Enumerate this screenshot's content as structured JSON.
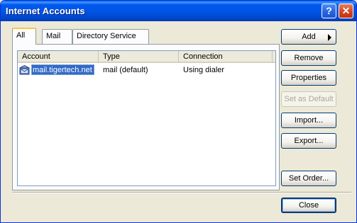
{
  "window": {
    "title": "Internet Accounts",
    "help_glyph": "?",
    "close_glyph": "✕"
  },
  "tabs": [
    {
      "label": "All",
      "active": true
    },
    {
      "label": "Mail",
      "active": false
    },
    {
      "label": "Directory Service",
      "active": false
    }
  ],
  "list": {
    "columns": [
      "Account",
      "Type",
      "Connection"
    ],
    "rows": [
      {
        "account": "mail.tigertech.net",
        "type": "mail (default)",
        "connection": "Using dialer",
        "icon": "mail-account-icon",
        "selected": true
      }
    ]
  },
  "buttons": {
    "add": "Add",
    "remove": "Remove",
    "properties": "Properties",
    "set_as_default": "Set as Default",
    "import": "Import...",
    "export": "Export...",
    "set_order": "Set Order...",
    "close": "Close"
  },
  "colors": {
    "titlebar": "#0054e3",
    "selection": "#316ac5",
    "face": "#ece9d8",
    "active_tab_accent": "#ffc83c"
  }
}
